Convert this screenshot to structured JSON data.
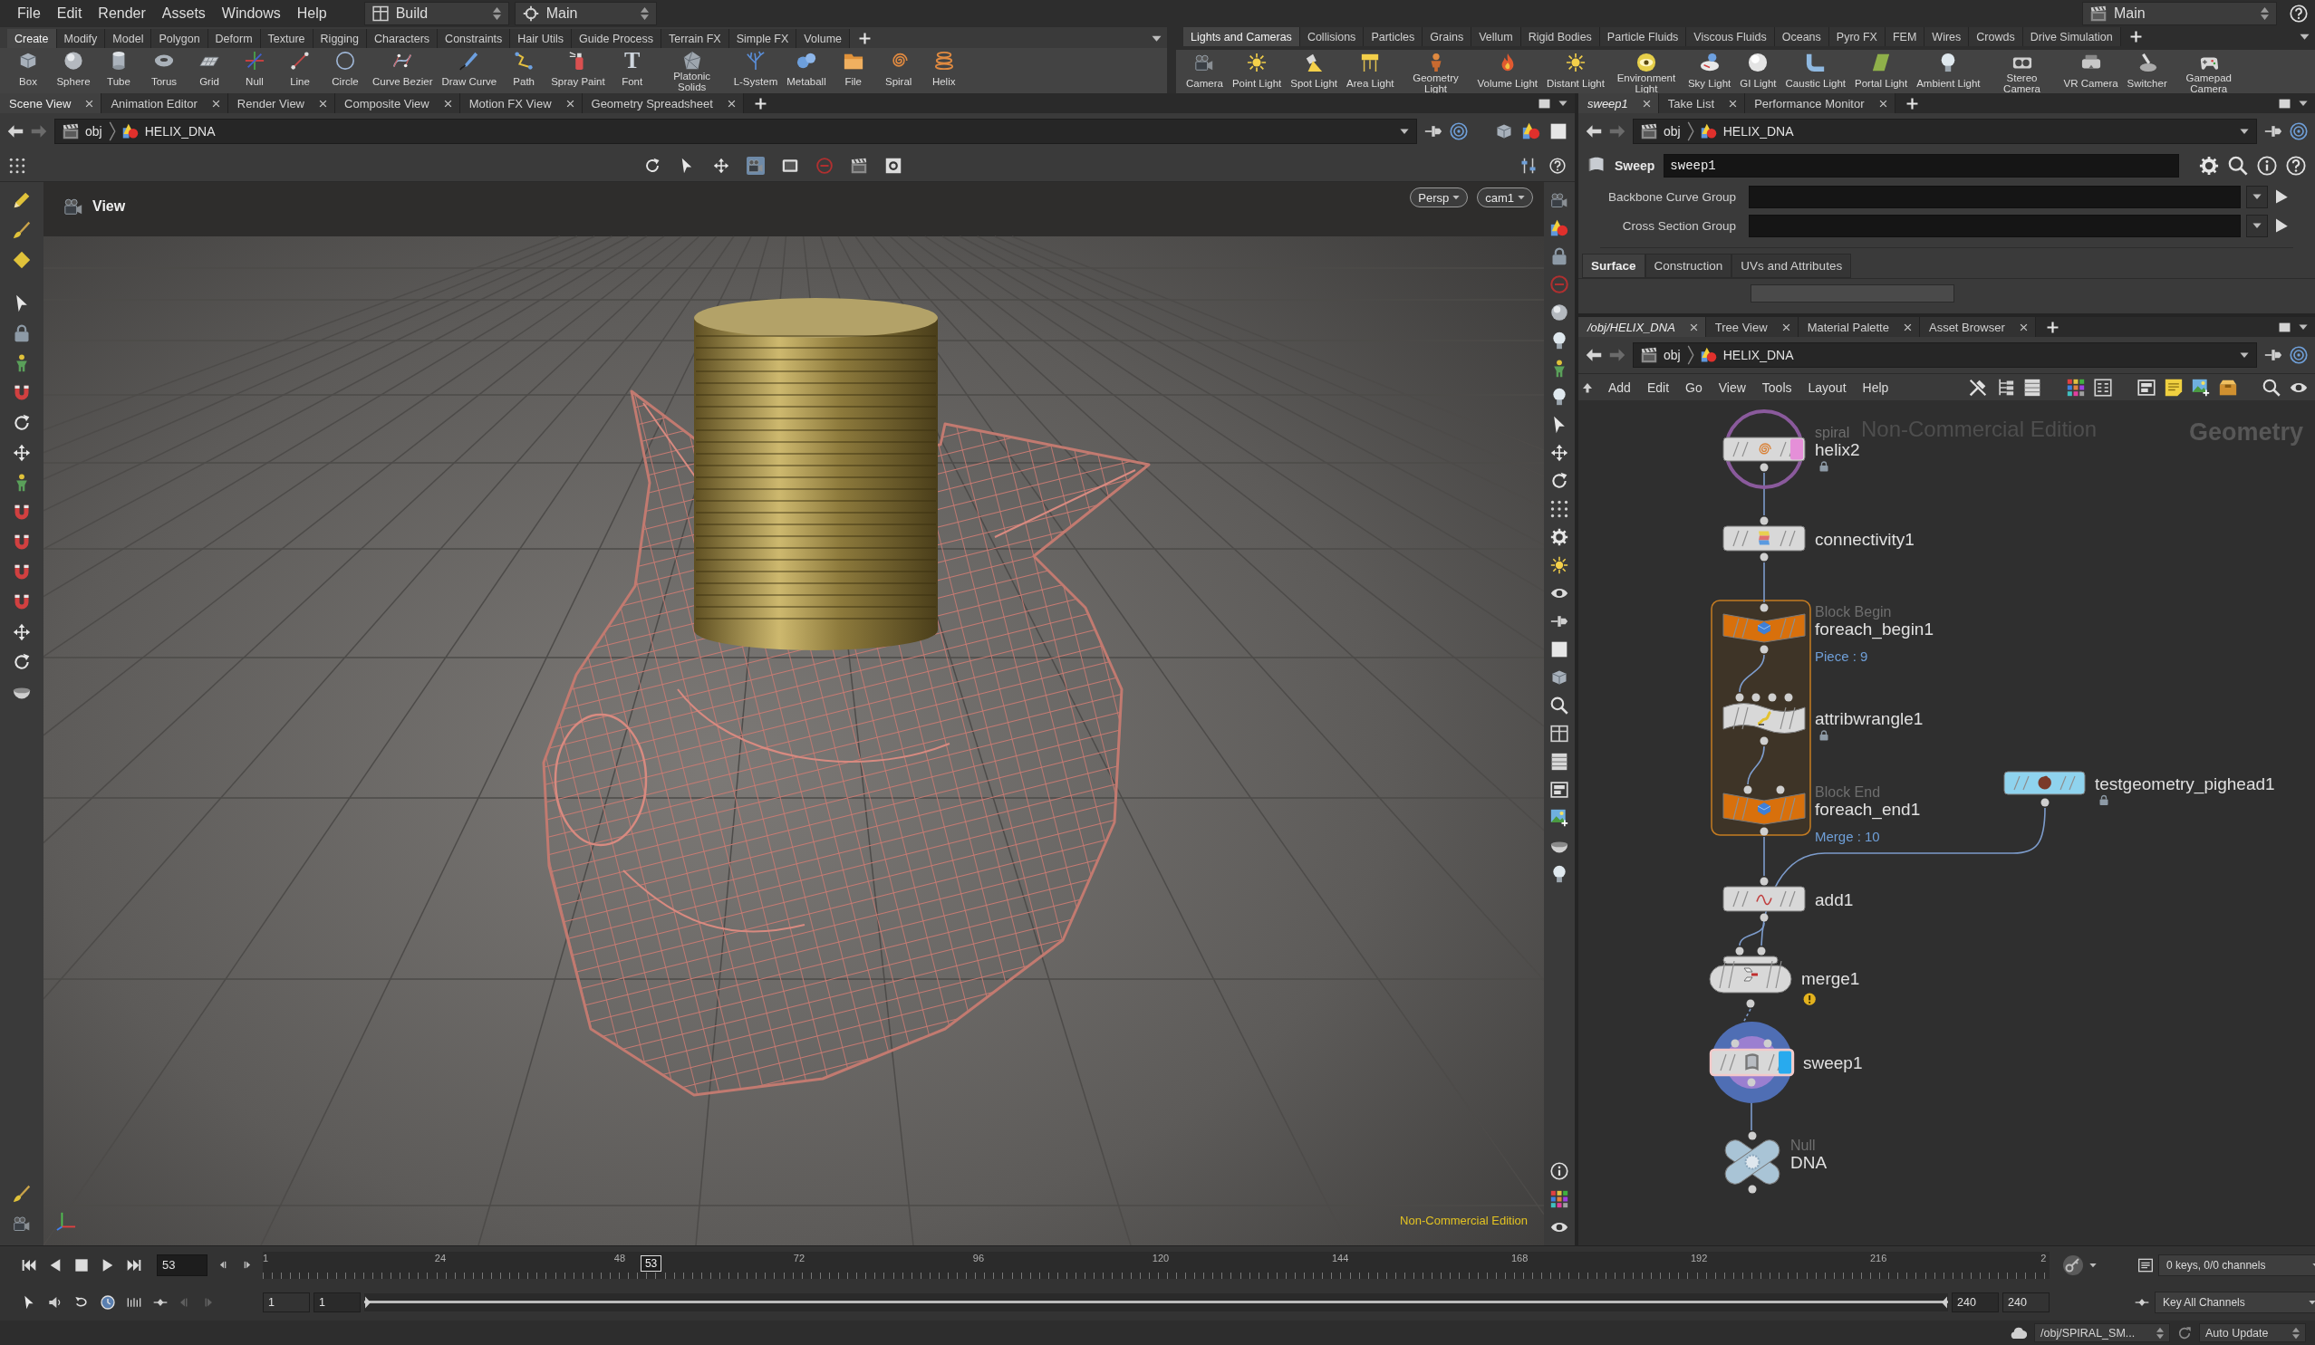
{
  "menu_bar": {
    "items": [
      "File",
      "Edit",
      "Render",
      "Assets",
      "Windows",
      "Help"
    ],
    "desktop_dropdown": "Build",
    "context_dropdown": "Main",
    "right_dropdown": "Main"
  },
  "shelf_left": {
    "tabs": [
      {
        "label": "Create",
        "selected": true
      },
      {
        "label": "Modify",
        "selected": false
      },
      {
        "label": "Model",
        "selected": false
      },
      {
        "label": "Polygon",
        "selected": false
      },
      {
        "label": "Deform",
        "selected": false
      },
      {
        "label": "Texture",
        "selected": false
      },
      {
        "label": "Rigging",
        "selected": false
      },
      {
        "label": "Characters",
        "selected": false
      },
      {
        "label": "Constraints",
        "selected": false
      },
      {
        "label": "Hair Utils",
        "selected": false
      },
      {
        "label": "Guide Process",
        "selected": false
      },
      {
        "label": "Terrain FX",
        "selected": false
      },
      {
        "label": "Simple FX",
        "selected": false
      },
      {
        "label": "Volume",
        "selected": false
      }
    ],
    "tools": [
      {
        "label": "Box"
      },
      {
        "label": "Sphere"
      },
      {
        "label": "Tube"
      },
      {
        "label": "Torus"
      },
      {
        "label": "Grid"
      },
      {
        "label": "Null"
      },
      {
        "label": "Line"
      },
      {
        "label": "Circle"
      },
      {
        "label": "Curve Bezier"
      },
      {
        "label": "Draw Curve"
      },
      {
        "label": "Path"
      },
      {
        "label": "Spray Paint"
      },
      {
        "label": "Font",
        "glyph": "T"
      },
      {
        "label": "Platonic Solids"
      },
      {
        "label": "L-System"
      },
      {
        "label": "Metaball"
      },
      {
        "label": "File"
      },
      {
        "label": "Spiral"
      },
      {
        "label": "Helix"
      }
    ]
  },
  "shelf_right": {
    "tabs": [
      {
        "label": "Lights and Cameras",
        "selected": true
      },
      {
        "label": "Collisions",
        "selected": false
      },
      {
        "label": "Particles",
        "selected": false
      },
      {
        "label": "Grains",
        "selected": false
      },
      {
        "label": "Vellum",
        "selected": false
      },
      {
        "label": "Rigid Bodies",
        "selected": false
      },
      {
        "label": "Particle Fluids",
        "selected": false
      },
      {
        "label": "Viscous Fluids",
        "selected": false
      },
      {
        "label": "Oceans",
        "selected": false
      },
      {
        "label": "Pyro FX",
        "selected": false
      },
      {
        "label": "FEM",
        "selected": false
      },
      {
        "label": "Wires",
        "selected": false
      },
      {
        "label": "Crowds",
        "selected": false
      },
      {
        "label": "Drive Simulation",
        "selected": false
      }
    ],
    "tools": [
      {
        "label": "Camera"
      },
      {
        "label": "Point Light"
      },
      {
        "label": "Spot Light"
      },
      {
        "label": "Area Light"
      },
      {
        "label": "Geometry Light"
      },
      {
        "label": "Volume Light"
      },
      {
        "label": "Distant Light"
      },
      {
        "label": "Environment Light"
      },
      {
        "label": "Sky Light"
      },
      {
        "label": "GI Light"
      },
      {
        "label": "Caustic Light"
      },
      {
        "label": "Portal Light"
      },
      {
        "label": "Ambient Light"
      },
      {
        "label": "Stereo Camera"
      },
      {
        "label": "VR Camera"
      },
      {
        "label": "Switcher"
      },
      {
        "label": "Gamepad Camera"
      }
    ]
  },
  "scene_pane": {
    "tabs": [
      {
        "label": "Scene View",
        "selected": true,
        "linked": false
      },
      {
        "label": "Animation Editor",
        "selected": false,
        "linked": false
      },
      {
        "label": "Render View",
        "selected": false,
        "linked": false
      },
      {
        "label": "Composite View",
        "selected": false,
        "linked": false
      },
      {
        "label": "Motion FX View",
        "selected": false,
        "linked": false
      },
      {
        "label": "Geometry Spreadsheet",
        "selected": false,
        "linked": false
      }
    ],
    "path": [
      "obj",
      "HELIX_DNA"
    ],
    "toolbar": [
      {
        "on": false
      },
      {
        "on": false
      },
      {
        "on": false
      },
      {
        "on": true
      },
      {
        "on": false
      },
      {
        "on": false
      },
      {
        "on": false
      },
      {
        "on": false
      }
    ],
    "viewport": {
      "title": "View",
      "projection": "Persp",
      "camera": "cam1",
      "edition_label": "Non-Commercial Edition"
    }
  },
  "parameter_pane": {
    "tabs": [
      {
        "label": "sweep1",
        "selected": true,
        "linked": true
      },
      {
        "label": "Take List",
        "selected": false,
        "linked": false
      },
      {
        "label": "Performance Monitor",
        "selected": false,
        "linked": false
      }
    ],
    "path": [
      "obj",
      "HELIX_DNA"
    ],
    "node_type": "Sweep",
    "node_name": "sweep1",
    "parameters": [
      {
        "label": "Backbone Curve Group"
      },
      {
        "label": "Cross Section Group"
      }
    ],
    "folders": [
      {
        "label": "Surface",
        "selected": true
      },
      {
        "label": "Construction",
        "selected": false
      },
      {
        "label": "UVs and Attributes",
        "selected": false
      }
    ]
  },
  "network_pane": {
    "tabs": [
      {
        "label": "/obj/HELIX_DNA",
        "selected": true,
        "linked": true
      },
      {
        "label": "Tree View",
        "selected": false,
        "linked": false
      },
      {
        "label": "Material Palette",
        "selected": false,
        "linked": false
      },
      {
        "label": "Asset Browser",
        "selected": false,
        "linked": false
      }
    ],
    "path": [
      "obj",
      "HELIX_DNA"
    ],
    "menu": [
      "Add",
      "Edit",
      "Go",
      "View",
      "Tools",
      "Layout",
      "Help"
    ],
    "edition_label": "Non-Commercial Edition",
    "context_label": "Geometry",
    "nodes": [
      {
        "name": "helix2",
        "type_label": "spiral",
        "kind": "standard",
        "color": "#d8d8d8",
        "template_flag": true,
        "display_flag": false,
        "selected": false,
        "badges": [
          {
            "kind": "lock"
          }
        ]
      },
      {
        "name": "connectivity1",
        "kind": "standard",
        "color": "#d8d8d8",
        "template_flag": false,
        "display_flag": false,
        "selected": false
      },
      {
        "name": "foreach_begin1",
        "type_label": "Block Begin",
        "info": "Piece : 9",
        "kind": "block",
        "color": "#d8700c",
        "template_flag": false,
        "display_flag": false,
        "selected": false
      },
      {
        "name": "attribwrangle1",
        "kind": "wrangle",
        "color": "#d8d8d8",
        "template_flag": false,
        "display_flag": false,
        "selected": false,
        "badges": [
          {
            "kind": "lock"
          }
        ]
      },
      {
        "name": "foreach_end1",
        "type_label": "Block End",
        "info": "Merge : 10",
        "kind": "block",
        "color": "#d8700c",
        "template_flag": false,
        "display_flag": false,
        "selected": false
      },
      {
        "name": "testgeometry_pighead1",
        "kind": "standard",
        "color": "#8fd3ee",
        "template_flag": false,
        "display_flag": false,
        "selected": false,
        "badges": [
          {
            "kind": "lock"
          }
        ]
      },
      {
        "name": "add1",
        "kind": "standard",
        "color": "#d8d8d8",
        "template_flag": false,
        "display_flag": false,
        "selected": false
      },
      {
        "name": "merge1",
        "kind": "merge",
        "color": "#d8d8d8",
        "template_flag": false,
        "display_flag": false,
        "selected": false,
        "badges": [
          {
            "kind": "warning"
          }
        ]
      },
      {
        "name": "sweep1",
        "kind": "standard",
        "color": "#d8d8d8",
        "template_flag": false,
        "display_flag": true,
        "selected": true
      },
      {
        "name": "DNA",
        "type_label": "Null",
        "kind": "null",
        "color": "#a9c4d6",
        "template_flag": false,
        "display_flag": false,
        "selected": false
      }
    ]
  },
  "timeline": {
    "current_frame": "53",
    "tick_labels": [
      "1",
      "24",
      "48",
      "72",
      "96",
      "120",
      "144",
      "168",
      "192",
      "216",
      "2"
    ],
    "playhead": {
      "label": "53",
      "level": 0.218
    },
    "range_start": "1",
    "playback_start": "1",
    "range_slider": {
      "level": 1
    },
    "playback_end": "240",
    "range_end": "240",
    "keys_info": "0 keys, 0/0 channels",
    "key_button": "Key All Channels"
  },
  "status_bar": {
    "path": "/obj/SPIRAL_SM...",
    "update_mode": "Auto Update"
  }
}
